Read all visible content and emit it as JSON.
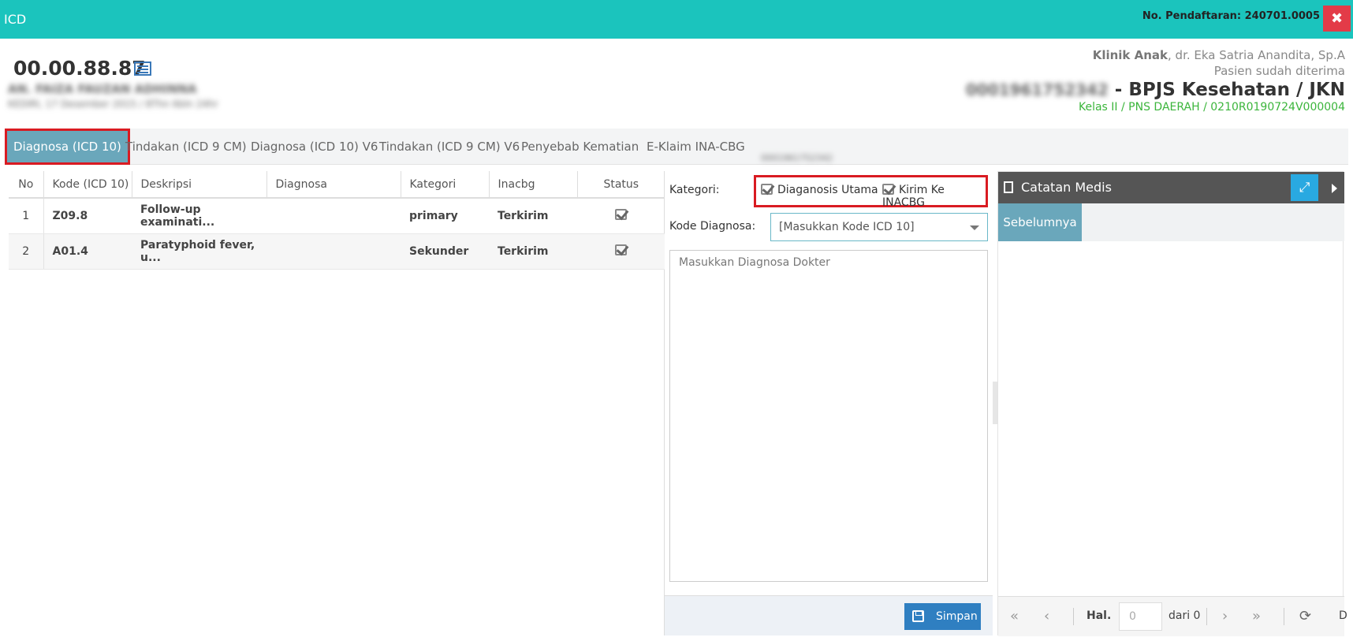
{
  "window": {
    "title": "ICD",
    "registration": "No. Pendaftaran: 240701.0005",
    "close_glyph": "✖"
  },
  "patient": {
    "rm_number": "00.00.88.87",
    "name": "AN. FAIZA FAUZAN ADHINNA",
    "dob": "KEDIRI, 17 Desember 2015 / 8Thn 6bln 24hr",
    "clinic": "Klinik Anak",
    "doctor": ", dr. Eka Satria Anandita, Sp.A",
    "status": "Pasien sudah diterima",
    "card_no": "0001961752342",
    "insurance": " - BPJS Kesehatan / JKN",
    "kelas": "Kelas II / PNS DAERAH / 0210R0190724V000004",
    "small_id": "0001961752342"
  },
  "tabs": [
    {
      "label": "Diagnosa (ICD 10)",
      "active": true
    },
    {
      "label": "Tindakan (ICD 9 CM)"
    },
    {
      "label": "Diagnosa (ICD 10) V6"
    },
    {
      "label": "Tindakan (ICD 9 CM) V6"
    },
    {
      "label": "Penyebab Kematian"
    },
    {
      "label": "E-Klaim INA-CBG"
    }
  ],
  "table": {
    "columns": [
      "No",
      "Kode (ICD 10)",
      "Deskripsi",
      "Diagnosa",
      "Kategori",
      "Inacbg",
      "Status"
    ],
    "rows": [
      {
        "no": "1",
        "kode": "Z09.8",
        "deskripsi": "Follow-up examinati...",
        "diagnosa": "",
        "kategori": "primary",
        "inacbg": "Terkirim",
        "status": "checked"
      },
      {
        "no": "2",
        "kode": "A01.4",
        "deskripsi": "Paratyphoid fever, u...",
        "diagnosa": "",
        "kategori": "Sekunder",
        "inacbg": "Terkirim",
        "status": "checked"
      }
    ]
  },
  "form": {
    "kategori_label": "Kategori:",
    "cb_utama": "Diaganosis Utama",
    "cb_inacbg": "Kirim Ke INACBG",
    "kode_label": "Kode Diagnosa:",
    "kode_placeholder": "[Masukkan Kode ICD 10]",
    "diagnosa_placeholder": "Masukkan Diagnosa Dokter",
    "save_label": "Simpan"
  },
  "catatan": {
    "title": "Catatan Medis",
    "tab": "Sebelumnya",
    "page_label": "Hal.",
    "page_value": "0",
    "of_label": "dari 0",
    "trailing": "D"
  },
  "colors": {
    "topbar": "#1bc4bd",
    "tab_active": "#6aa7bb",
    "highlight": "#d91b22",
    "button": "#2f7fc1",
    "kelas_text": "#3bb53b"
  }
}
